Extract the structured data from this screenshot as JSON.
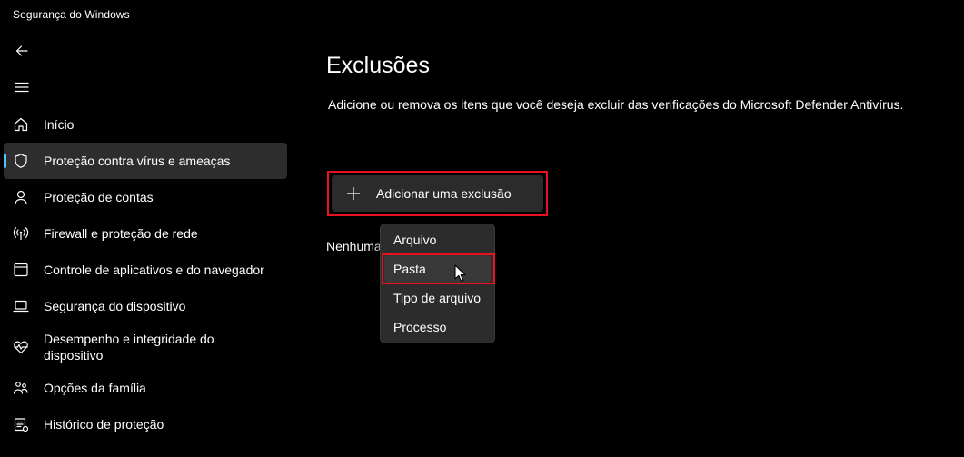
{
  "window": {
    "title": "Segurança do Windows"
  },
  "nav": {
    "back_icon": "back-arrow-icon",
    "menu_icon": "hamburger-menu-icon"
  },
  "sidebar": {
    "items": [
      {
        "label": "Início",
        "icon": "home-icon",
        "selected": false
      },
      {
        "label": "Proteção contra vírus e ameaças",
        "icon": "shield-icon",
        "selected": true
      },
      {
        "label": "Proteção de contas",
        "icon": "person-icon",
        "selected": false
      },
      {
        "label": "Firewall e proteção de rede",
        "icon": "wifi-antenna-icon",
        "selected": false
      },
      {
        "label": "Controle de aplicativos e do navegador",
        "icon": "app-window-icon",
        "selected": false
      },
      {
        "label": "Segurança do dispositivo",
        "icon": "laptop-icon",
        "selected": false
      },
      {
        "label": "Desempenho e integridade do\ndispositivo",
        "icon": "heart-pulse-icon",
        "selected": false
      },
      {
        "label": "Opções da família",
        "icon": "family-icon",
        "selected": false
      },
      {
        "label": "Histórico de proteção",
        "icon": "history-icon",
        "selected": false
      }
    ]
  },
  "main": {
    "title": "Exclusões",
    "description": "Adicione ou remova os itens que você deseja excluir das verificações do Microsoft Defender Antivírus.",
    "add_button_label": "Adicionar uma exclusão",
    "status_text": "Nenhuma exclusão existente."
  },
  "dropdown": {
    "items": [
      "Arquivo",
      "Pasta",
      "Tipo de arquivo",
      "Processo"
    ],
    "hovered": "Pasta"
  },
  "colors": {
    "background": "#000000",
    "selected_item": "#2d2d2d",
    "accent": "#4cc2ff",
    "highlight_border": "#e81123",
    "menu_bg": "#2c2c2c"
  }
}
